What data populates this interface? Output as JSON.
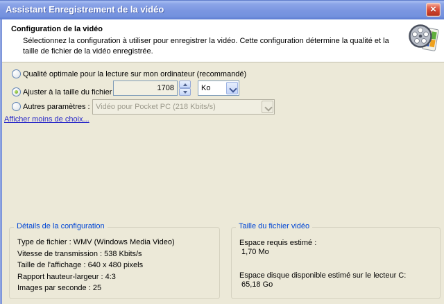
{
  "window": {
    "title": "Assistant Enregistrement de la vidéo"
  },
  "icons": {
    "close_glyph": "×",
    "movie_maker": "film-reel-with-windows-colors"
  },
  "header": {
    "title": "Configuration de la vidéo",
    "description": "Sélectionnez la configuration à utiliser pour enregistrer la vidéo. Cette configuration détermine la qualité et la taille de fichier de la vidéo enregistrée."
  },
  "options": {
    "best_quality": {
      "label": "Qualité optimale pour la lecture sur mon ordinateur (recommandé)",
      "selected": false
    },
    "fit_file_size": {
      "label": "Ajuster à la taille du fichier :",
      "selected": true,
      "size_value": "1708",
      "unit": "Ko"
    },
    "other_settings": {
      "label": "Autres paramètres :",
      "selected": false,
      "preset": "Vidéo pour Pocket PC (218 Kbits/s)",
      "enabled": false
    }
  },
  "link": {
    "label": "Afficher moins de choix..."
  },
  "groups": {
    "details": {
      "title": "Détails de la configuration",
      "lines": [
        "Type de fichier : WMV (Windows Media Video)",
        "Vitesse de transmission : 538 Kbits/s",
        "Taille de l'affichage : 640 x 480 pixels",
        "Rapport hauteur-largeur : 4:3",
        "Images par seconde : 25"
      ]
    },
    "file_size": {
      "title": "Taille du fichier vidéo",
      "required_label": "Espace requis estimé :",
      "required_value": "1,70 Mo",
      "available_label": "Espace disque disponible estimé sur le lecteur C:",
      "available_value": "65,18 Go"
    }
  },
  "colors": {
    "dialog_bg": "#ECE9D8",
    "titlebar_blue": "#7B96E1",
    "group_title_blue": "#0046D5",
    "link_blue": "#2B2BC8",
    "radio_selected_green": "#6DA21E",
    "close_red": "#C23A26"
  }
}
